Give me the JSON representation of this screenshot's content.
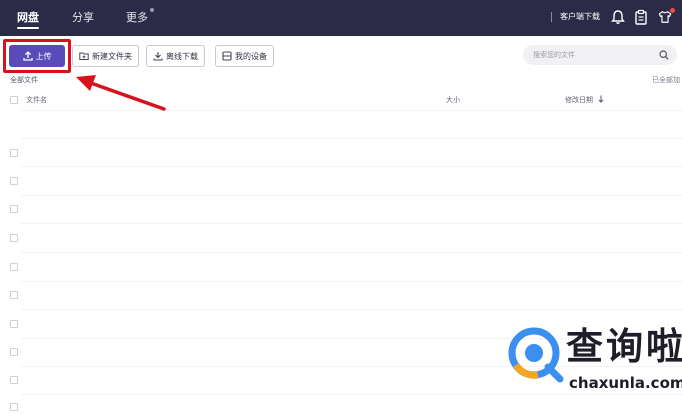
{
  "topbar": {
    "tabs": [
      {
        "label": "网盘",
        "active": true
      },
      {
        "label": "分享",
        "active": false
      },
      {
        "label": "更多",
        "active": false
      }
    ],
    "client_download": "客户端下载",
    "icons": [
      "bell-icon",
      "clipboard-icon",
      "shirt-icon"
    ]
  },
  "toolbar": {
    "upload_label": "上传",
    "new_folder_label": "新建文件夹",
    "offline_download_label": "离线下载",
    "my_devices_label": "我的设备"
  },
  "search": {
    "placeholder": "搜索您的文件"
  },
  "breadcrumb": {
    "current": "全部文件"
  },
  "status": {
    "loaded_text": "已全部加"
  },
  "file_list": {
    "columns": [
      "文件名",
      "大小",
      "修改日期"
    ],
    "sort_indicator": "arrow-down-icon",
    "rows": []
  },
  "watermark": {
    "brand": "查询啦",
    "url": "chaxunla.com"
  },
  "colors": {
    "topbar_bg": "#2b2b48",
    "accent": "#5a4bb8",
    "highlight": "#d8121c",
    "watermark_logo": "#3b8ff0"
  }
}
